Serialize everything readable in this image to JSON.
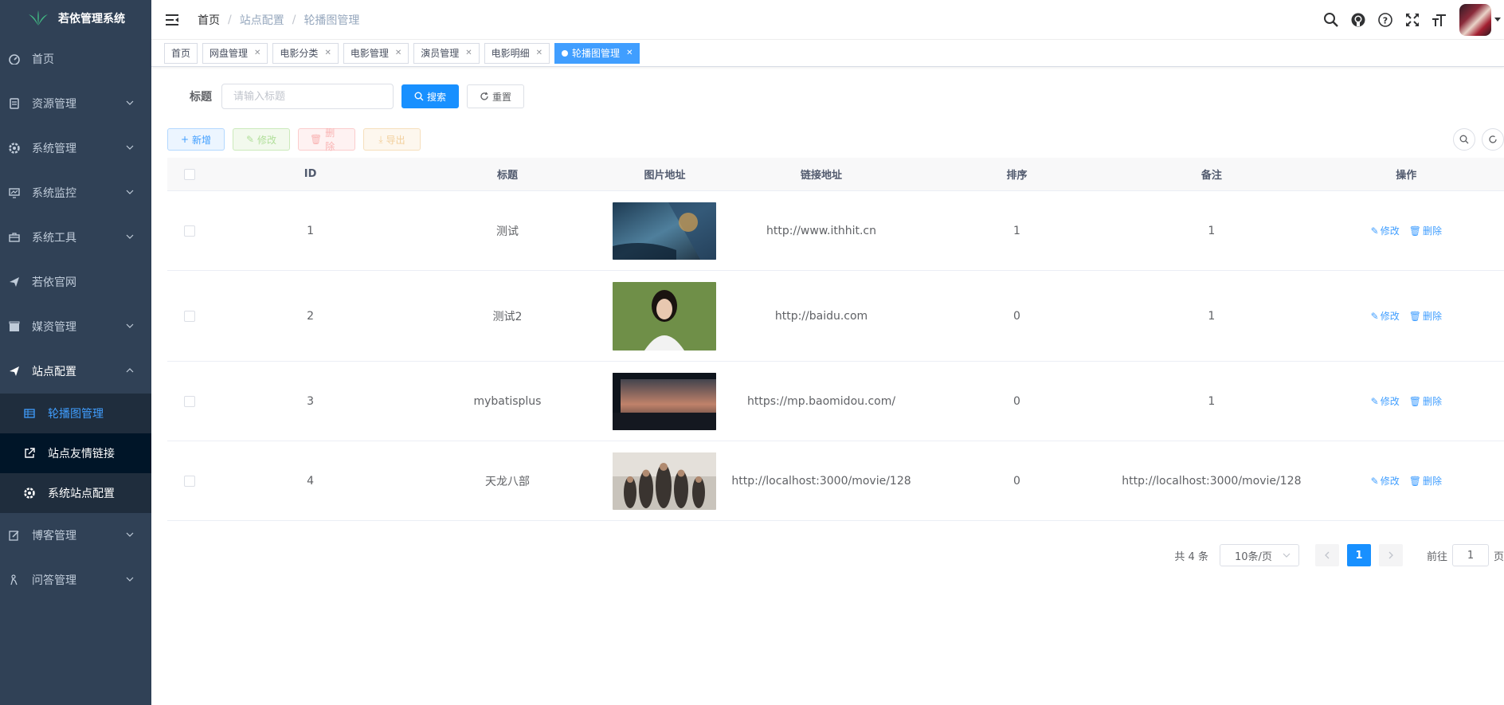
{
  "app": {
    "title": "若依管理系统"
  },
  "sidebar": {
    "items": [
      {
        "label": "首页",
        "icon": "dashboard-icon"
      },
      {
        "label": "资源管理",
        "icon": "document-icon"
      },
      {
        "label": "系统管理",
        "icon": "gear-icon"
      },
      {
        "label": "系统监控",
        "icon": "monitor-icon"
      },
      {
        "label": "系统工具",
        "icon": "toolbox-icon"
      },
      {
        "label": "若依官网",
        "icon": "send-icon"
      },
      {
        "label": "媒资管理",
        "icon": "clapper-icon"
      },
      {
        "label": "站点配置",
        "icon": "send-icon"
      },
      {
        "label": "博客管理",
        "icon": "edit-icon"
      },
      {
        "label": "问答管理",
        "icon": "question-icon"
      }
    ],
    "sub_items": [
      {
        "label": "轮播图管理",
        "icon": "table-icon"
      },
      {
        "label": "站点友情链接",
        "icon": "external-link-icon"
      },
      {
        "label": "系统站点配置",
        "icon": "gear-icon"
      }
    ]
  },
  "breadcrumb": [
    "首页",
    "站点配置",
    "轮播图管理"
  ],
  "tags": [
    "首页",
    "网盘管理",
    "电影分类",
    "电影管理",
    "演员管理",
    "电影明细",
    "轮播图管理"
  ],
  "search": {
    "label": "标题",
    "placeholder": "请输入标题",
    "search_btn": "搜索",
    "reset_btn": "重置"
  },
  "toolbar": {
    "add": "新增",
    "edit": "修改",
    "delete": "删除",
    "export": "导出"
  },
  "table": {
    "columns": [
      "ID",
      "标题",
      "图片地址",
      "链接地址",
      "排序",
      "备注",
      "操作"
    ],
    "rows": [
      {
        "id": "1",
        "title": "测试",
        "link": "http://www.ithhit.cn",
        "sort": "1",
        "remark": "1"
      },
      {
        "id": "2",
        "title": "测试2",
        "link": "http://baidu.com",
        "sort": "0",
        "remark": "1"
      },
      {
        "id": "3",
        "title": "mybatisplus",
        "link": "https://mp.baomidou.com/",
        "sort": "0",
        "remark": "1"
      },
      {
        "id": "4",
        "title": "天龙八部",
        "link": "http://localhost:3000/movie/128",
        "sort": "0",
        "remark": "http://localhost:3000/movie/128"
      }
    ],
    "op_edit": "修改",
    "op_delete": "删除"
  },
  "pagination": {
    "total": "共 4 条",
    "page_size": "10条/页",
    "current": "1",
    "goto_prefix": "前往",
    "goto_value": "1",
    "goto_suffix": "页"
  },
  "colors": {
    "sidebar_bg": "#304156",
    "primary": "#1890ff",
    "active_menu": "#409eff"
  }
}
